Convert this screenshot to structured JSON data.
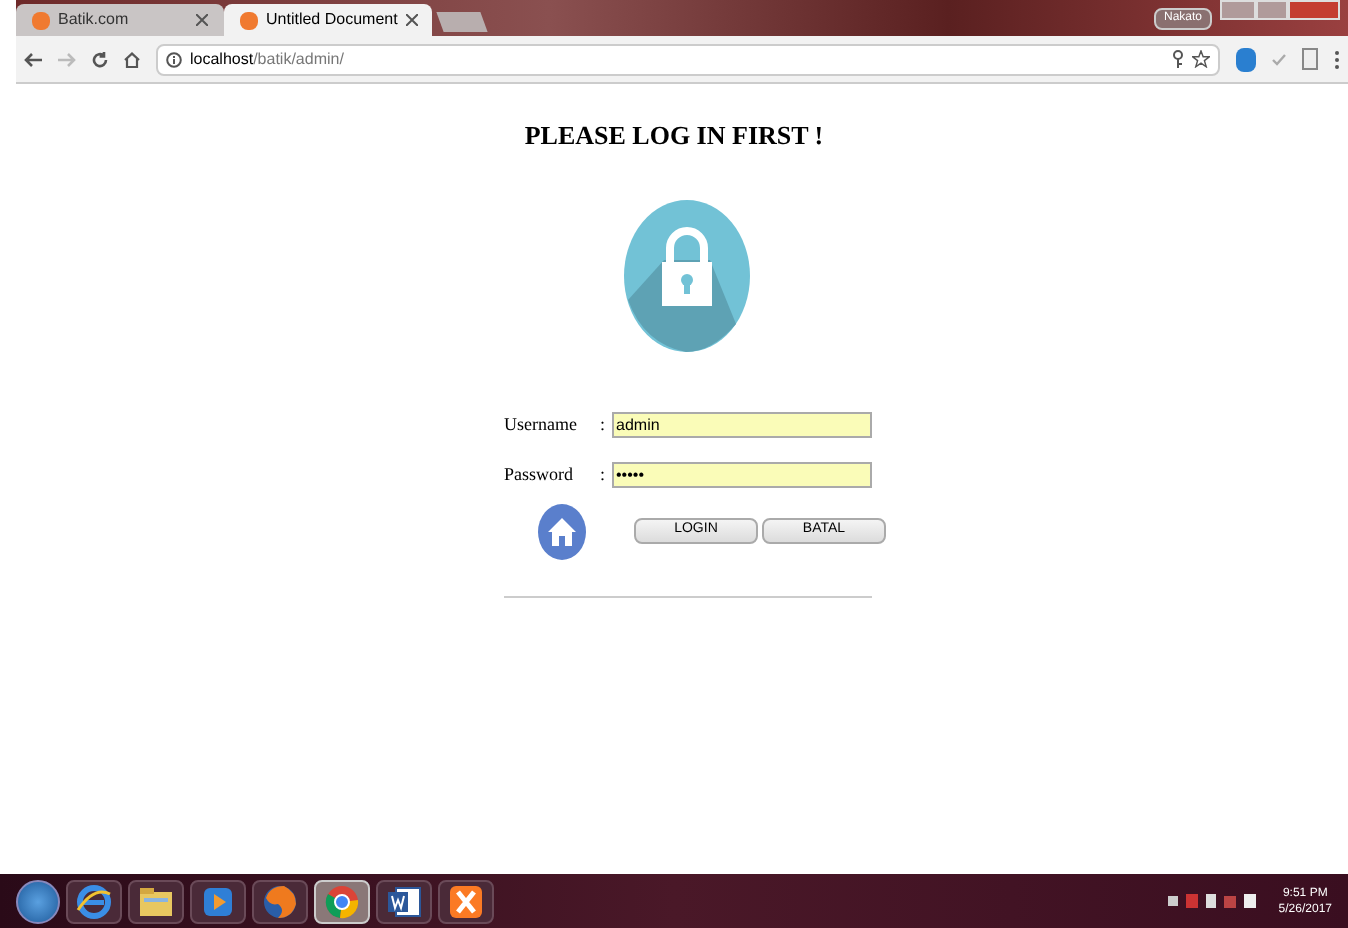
{
  "browser": {
    "tabs": [
      {
        "title": "Batik.com",
        "selected": false
      },
      {
        "title": "Untitled Document",
        "selected": true
      }
    ],
    "user_badge": "Nakato",
    "address": {
      "host": "localhost",
      "path": "/batik/admin/"
    }
  },
  "page": {
    "heading": "PLEASE LOG IN FIRST !",
    "fields": [
      {
        "label": "Username",
        "separator": ":",
        "value": "admin"
      },
      {
        "label": "Password",
        "separator": ":",
        "value": "•••••"
      }
    ],
    "buttons": [
      "LOGIN",
      "BATAL"
    ]
  },
  "taskbar": {
    "apps": [
      {
        "kind": "ie",
        "selected": false
      },
      {
        "kind": "folder",
        "selected": false
      },
      {
        "kind": "media",
        "selected": false
      },
      {
        "kind": "firefox",
        "selected": false
      },
      {
        "kind": "chrome",
        "selected": true
      },
      {
        "kind": "word",
        "selected": false
      },
      {
        "kind": "xampp",
        "selected": false
      }
    ],
    "time": "9:51 PM",
    "date": "5/26/2017"
  }
}
